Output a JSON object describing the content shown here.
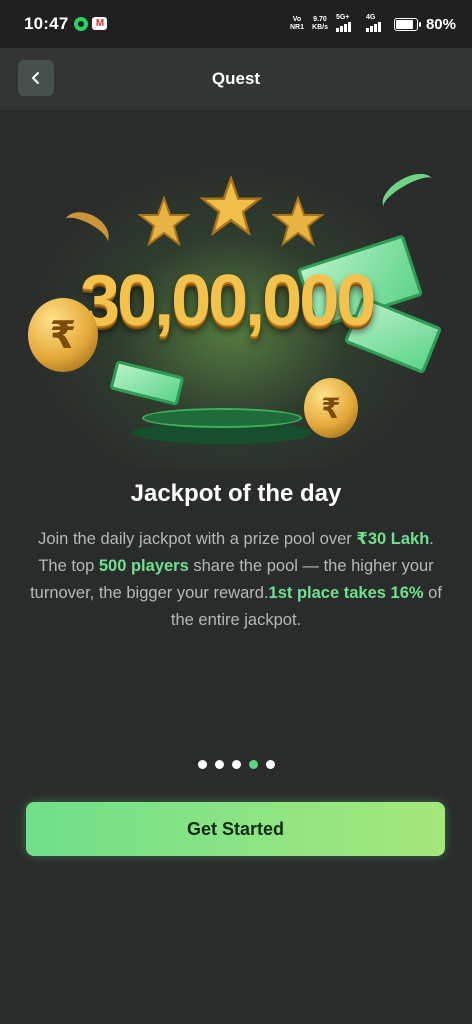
{
  "status_bar": {
    "time": "10:47",
    "volte": "Vo",
    "volte2": "NR1",
    "speed_value": "9.70",
    "speed_unit": "KB/s",
    "net1": "5G+",
    "net2": "4G",
    "battery": "80%"
  },
  "header": {
    "title": "Quest",
    "back_icon": "chevron-left-icon"
  },
  "hero": {
    "amount": "30,00,000",
    "coin_symbol": "₹"
  },
  "content": {
    "title": "Jackpot of the day",
    "desc_parts": {
      "p1": "Join the daily jackpot with a prize pool over ",
      "h1": "₹30 Lakh",
      "p2": ". The top ",
      "h2": "500 players",
      "p3": " share the pool — the higher your turnover, the bigger your reward.",
      "h3": "1st place takes 16%",
      "p4": " of the entire jackpot."
    }
  },
  "pager": {
    "total": 5,
    "active_index": 3
  },
  "cta": {
    "label": "Get Started"
  },
  "colors": {
    "background": "#2a2c2b",
    "accent": "#6fe08f",
    "gold": "#f3c24d"
  }
}
